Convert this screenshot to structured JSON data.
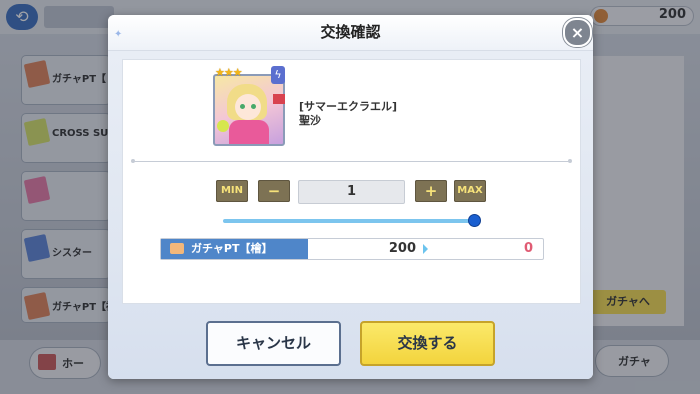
{
  "background": {
    "currency_value": "200",
    "list_items": [
      "ガチャPT【",
      "CROSS SUMMER",
      "",
      "シスター",
      "ガチャPT【神"
    ],
    "gacha_button": "ガチャへ",
    "home_label": "ホー",
    "gacha_tab_label": "ガチャ"
  },
  "dialog": {
    "title": "交換確認",
    "close_icon": "×",
    "item": {
      "stars": "★★★",
      "attribute_icon": "lightning-bolt",
      "series": "[サマーエクラエル]",
      "name": "聖沙"
    },
    "quantity": {
      "min_label": "MIN",
      "minus_label": "−",
      "value": "1",
      "plus_label": "+",
      "max_label": "MAX",
      "slider_fraction": 1.0
    },
    "exchange": {
      "currency_label": "ガチャPT【檜】",
      "have": "200",
      "after": "0"
    },
    "buttons": {
      "cancel": "キャンセル",
      "confirm": "交換する"
    }
  },
  "colors": {
    "accent_blue": "#4f86c9",
    "confirm_yellow": "#f3d43d",
    "after_red": "#e05b73"
  }
}
